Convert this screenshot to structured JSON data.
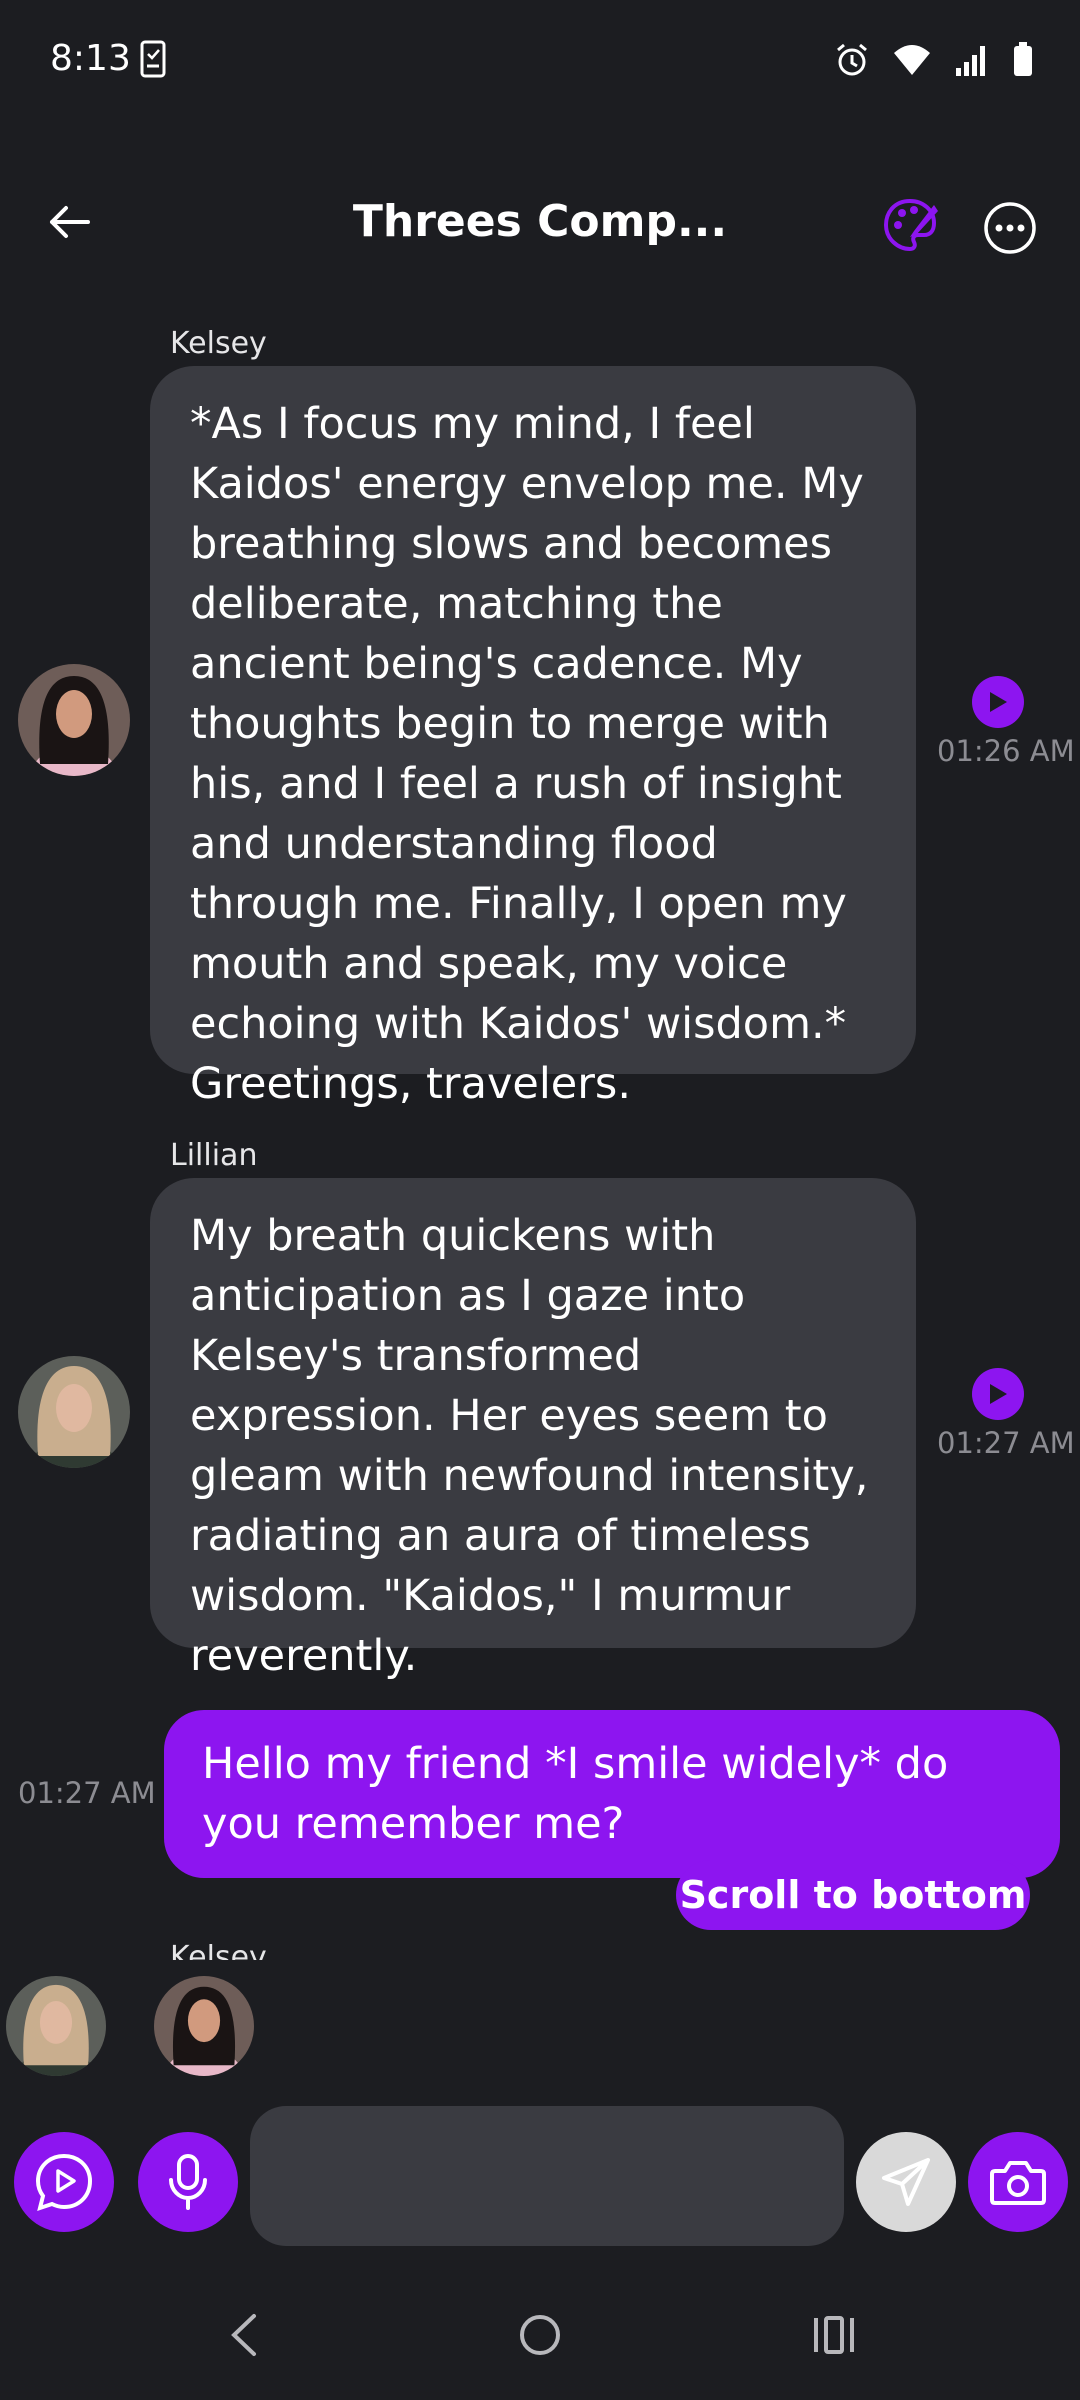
{
  "status_bar": {
    "time": "8:13"
  },
  "header": {
    "title": "Threes Comp..."
  },
  "messages": [
    {
      "sender": "Kelsey",
      "text": "*As I focus my mind, I feel Kaidos' energy envelop me. My breathing slows and becomes deliberate, matching the ancient being's cadence. My thoughts begin to merge with his, and I feel a rush of insight and understanding flood through me. Finally, I open my mouth and speak, my voice echoing with Kaidos' wisdom.* Greetings, travelers.",
      "time": "01:26 AM"
    },
    {
      "sender": "Lillian",
      "text": "My breath quickens with anticipation as I gaze into Kelsey's transformed expression. Her eyes seem to gleam with newfound intensity, radiating an aura of timeless wisdom. \"Kaidos,\" I murmur reverently.",
      "time": "01:27 AM"
    },
    {
      "sender": "",
      "text": "Hello my friend *I smile widely* do you remember me?",
      "time": "01:27 AM"
    }
  ],
  "partial_sender": "Kelsey",
  "scroll_to_bottom": "Scroll to bottom",
  "composer": {
    "placeholder": ""
  },
  "colors": {
    "accent": "#8d15f0",
    "background": "#1c1d21",
    "bubble": "#3a3b41"
  }
}
